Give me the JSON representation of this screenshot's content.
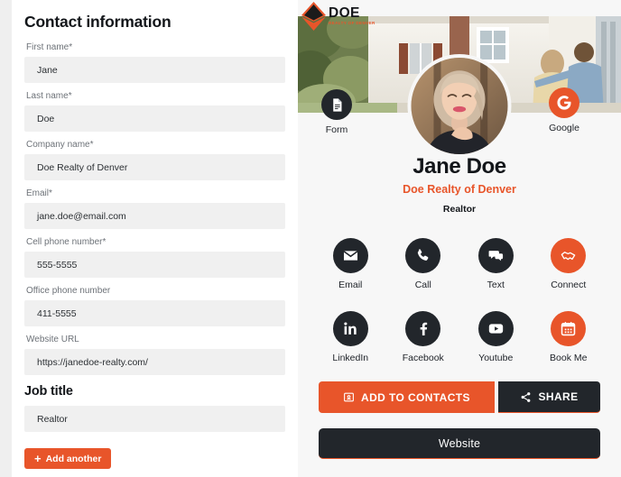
{
  "form": {
    "title": "Contact information",
    "fields": [
      {
        "label": "First name*",
        "value": "Jane",
        "name": "first-name"
      },
      {
        "label": "Last name*",
        "value": "Doe",
        "name": "last-name"
      },
      {
        "label": "Company name*",
        "value": "Doe Realty of Denver",
        "name": "company-name"
      },
      {
        "label": "Email*",
        "value": "jane.doe@email.com",
        "name": "email"
      },
      {
        "label": "Cell phone number*",
        "value": "555-5555",
        "name": "cell-phone"
      },
      {
        "label": "Office phone number",
        "value": "411-5555",
        "name": "office-phone"
      },
      {
        "label": "Website URL",
        "value": "https://janedoe-realty.com/",
        "name": "website-url"
      }
    ],
    "job_title_heading": "Job title",
    "job_title_value": "Realtor",
    "add_another_label": "Add another",
    "add_another_plus": "+"
  },
  "card": {
    "logo": {
      "name": "DOE",
      "subtitle": "REALTY OF DENVER"
    },
    "hero_badges": [
      {
        "label": "Form",
        "icon": "document-icon",
        "style": "dark"
      },
      {
        "label": "Google",
        "icon": "google-icon",
        "style": "orange"
      }
    ],
    "person": {
      "name": "Jane Doe",
      "company": "Doe Realty of Denver",
      "role": "Realtor"
    },
    "actions_row1": [
      {
        "label": "Email",
        "icon": "envelope-icon",
        "style": "dark"
      },
      {
        "label": "Call",
        "icon": "phone-icon",
        "style": "dark"
      },
      {
        "label": "Text",
        "icon": "chat-icon",
        "style": "dark"
      },
      {
        "label": "Connect",
        "icon": "handshake-icon",
        "style": "orange"
      }
    ],
    "actions_row2": [
      {
        "label": "LinkedIn",
        "icon": "linkedin-icon",
        "style": "dark"
      },
      {
        "label": "Facebook",
        "icon": "facebook-icon",
        "style": "dark"
      },
      {
        "label": "Youtube",
        "icon": "youtube-icon",
        "style": "dark"
      },
      {
        "label": "Book Me",
        "icon": "calendar-icon",
        "style": "orange"
      }
    ],
    "buttons": {
      "add_to_contacts": "ADD TO CONTACTS",
      "share": "SHARE",
      "website": "Website"
    }
  },
  "colors": {
    "accent": "#e8552a",
    "dark": "#22262b",
    "field_bg": "#f0f0f0",
    "card_bg": "#f7f7f7"
  }
}
